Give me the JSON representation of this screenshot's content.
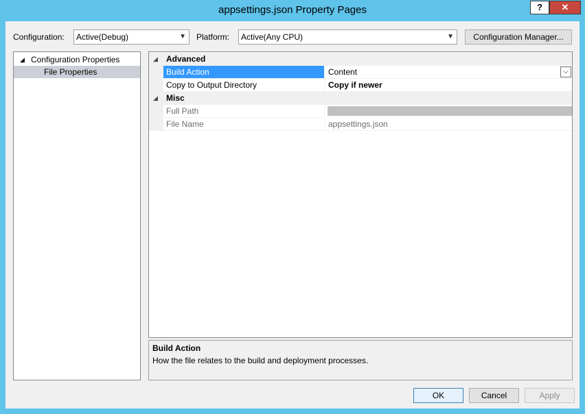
{
  "window": {
    "title": "appsettings.json Property Pages",
    "help_label": "?",
    "close_label": "✕"
  },
  "toolbar": {
    "configuration_label": "Configuration:",
    "configuration_value": "Active(Debug)",
    "platform_label": "Platform:",
    "platform_value": "Active(Any CPU)",
    "config_manager_label": "Configuration Manager..."
  },
  "tree": {
    "items": [
      {
        "label": "Configuration Properties",
        "expanded": true
      },
      {
        "label": "File Properties",
        "selected": true
      }
    ]
  },
  "grid": {
    "categories": [
      {
        "name": "Advanced",
        "properties": [
          {
            "name": "Build Action",
            "value": "Content",
            "selected": true,
            "has_dropdown": true
          },
          {
            "name": "Copy to Output Directory",
            "value": "Copy if newer",
            "bold": true
          }
        ]
      },
      {
        "name": "Misc",
        "properties": [
          {
            "name": "Full Path",
            "value": "",
            "readonly": true,
            "redacted": true
          },
          {
            "name": "File Name",
            "value": "appsettings.json",
            "readonly": true
          }
        ]
      }
    ]
  },
  "description": {
    "title": "Build Action",
    "text": "How the file relates to the build and deployment processes."
  },
  "footer": {
    "ok_label": "OK",
    "cancel_label": "Cancel",
    "apply_label": "Apply"
  },
  "icons": {
    "expanded": "◢",
    "dropdown": "⌵"
  },
  "colors": {
    "frame": "#5fc3ea",
    "selection": "#3399ff",
    "tree_selection": "#cdcfd8",
    "close": "#c7473e"
  }
}
